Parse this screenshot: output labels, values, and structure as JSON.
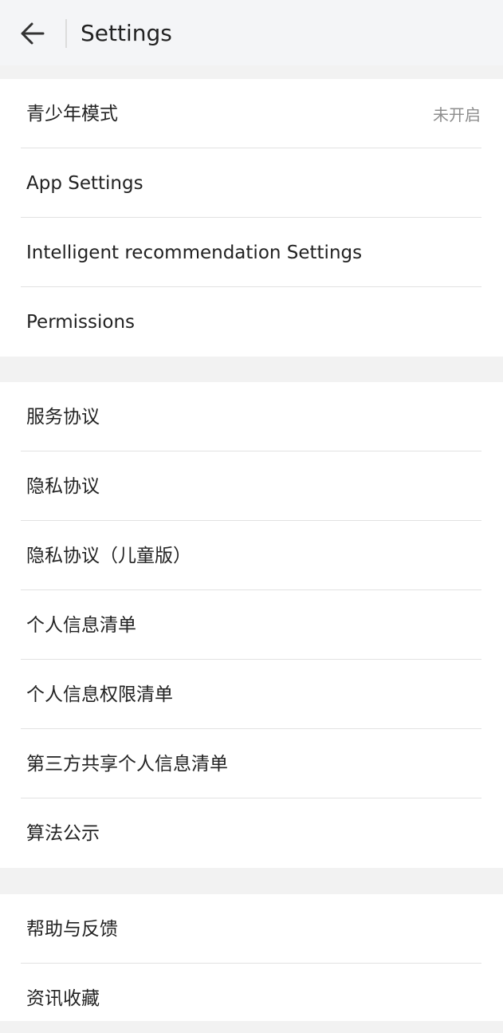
{
  "header": {
    "title": "Settings"
  },
  "section1": [
    {
      "label": "青少年模式",
      "value": "未开启"
    },
    {
      "label": "App Settings"
    },
    {
      "label": "Intelligent recommendation Settings"
    },
    {
      "label": "Permissions"
    }
  ],
  "section2": [
    {
      "label": "服务协议"
    },
    {
      "label": "隐私协议"
    },
    {
      "label": "隐私协议（儿童版）"
    },
    {
      "label": "个人信息清单"
    },
    {
      "label": "个人信息权限清单"
    },
    {
      "label": "第三方共享个人信息清单"
    },
    {
      "label": "算法公示"
    }
  ],
  "section3": [
    {
      "label": "帮助与反馈"
    },
    {
      "label": "资讯收藏"
    }
  ],
  "colors": {
    "header_bg": "#f4f5f7",
    "page_bg": "#f2f2f2",
    "text": "#222222",
    "secondary_text": "#8d8d8d",
    "separator": "#e2e2e2"
  },
  "icons": {
    "back": "arrow-left-icon"
  }
}
